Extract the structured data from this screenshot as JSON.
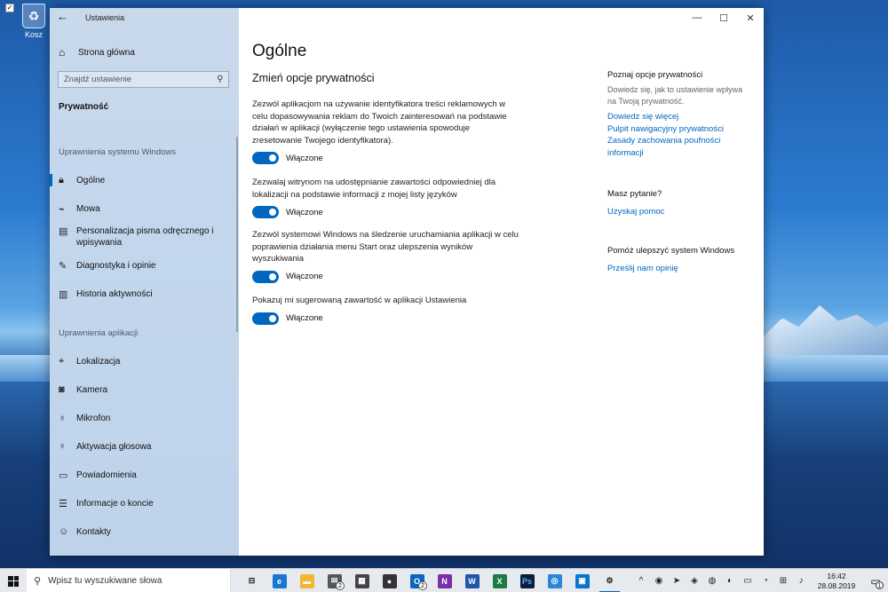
{
  "desktop": {
    "recycle_bin_label": "Kosz"
  },
  "window": {
    "title": "Ustawienia",
    "controls": {
      "minimize": "—",
      "maximize": "☐",
      "close": "✕"
    }
  },
  "sidebar": {
    "home_label": "Strona główna",
    "search_placeholder": "Znajdź ustawienie",
    "current_section": "Prywatność",
    "groups": [
      {
        "header": "Uprawnienia systemu Windows"
      },
      {
        "header": "Uprawnienia aplikacji"
      }
    ],
    "items": [
      {
        "label": "Ogólne",
        "icon": "lock-icon"
      },
      {
        "label": "Mowa",
        "icon": "speech-icon"
      },
      {
        "label": "Personalizacja pisma odręcznego i wpisywania",
        "icon": "clipboard-icon"
      },
      {
        "label": "Diagnostyka i opinie",
        "icon": "feedback-icon"
      },
      {
        "label": "Historia aktywności",
        "icon": "history-icon"
      },
      {
        "label": "Lokalizacja",
        "icon": "location-icon"
      },
      {
        "label": "Kamera",
        "icon": "camera-icon"
      },
      {
        "label": "Mikrofon",
        "icon": "microphone-icon"
      },
      {
        "label": "Aktywacja głosowa",
        "icon": "voice-activation-icon"
      },
      {
        "label": "Powiadomienia",
        "icon": "notifications-icon"
      },
      {
        "label": "Informacje o koncie",
        "icon": "account-info-icon"
      },
      {
        "label": "Kontakty",
        "icon": "contacts-icon"
      }
    ]
  },
  "main": {
    "title": "Ogólne",
    "subtitle": "Zmień opcje prywatności",
    "options": [
      {
        "text": "Zezwól aplikacjom na używanie identyfikatora treści reklamowych w celu dopasowywania reklam do Twoich zainteresowań na podstawie działań w aplikacji (wyłączenie tego ustawienia spowoduje zresetowanie Twojego identyfikatora).",
        "state": "Włączone",
        "on": true
      },
      {
        "text": "Zezwalaj witrynom na udostępnianie zawartości odpowiedniej dla lokalizacji na podstawie informacji z mojej listy języków",
        "state": "Włączone",
        "on": true
      },
      {
        "text": "Zezwól systemowi Windows na śledzenie uruchamiania aplikacji w celu poprawienia działania menu Start oraz ulepszenia wyników wyszukiwania",
        "state": "Włączone",
        "on": true
      },
      {
        "text": "Pokazuj mi sugerowaną zawartość w aplikacji Ustawienia",
        "state": "Włączone",
        "on": true
      }
    ]
  },
  "aside": {
    "privacy": {
      "header": "Poznaj opcje prywatności",
      "text": "Dowiedz się, jak to ustawienie wpływa na Twoją prywatność.",
      "links": [
        "Dowiedz się więcej",
        "Pulpit nawigacyjny prywatności",
        "Zasady zachowania poufności informacji"
      ]
    },
    "question": {
      "header": "Masz pytanie?",
      "link": "Uzyskaj pomoc"
    },
    "improve": {
      "header": "Pomóż ulepszyć system Windows",
      "link": "Prześlij nam opinię"
    }
  },
  "taskbar": {
    "search_placeholder": "Wpisz tu wyszukiwane słowa",
    "apps": [
      {
        "name": "task-view-icon",
        "glyph": "⊟",
        "color": "#e6e9ee",
        "fg": "#222"
      },
      {
        "name": "edge-icon",
        "glyph": "e",
        "color": "#1976d2",
        "fg": "#fff"
      },
      {
        "name": "file-explorer-icon",
        "glyph": "▬",
        "color": "#f2b630",
        "fg": "#fff"
      },
      {
        "name": "mail-icon",
        "glyph": "✉",
        "color": "#555",
        "fg": "#fff",
        "badge": "2"
      },
      {
        "name": "calendar-icon",
        "glyph": "▦",
        "color": "#444",
        "fg": "#fff"
      },
      {
        "name": "people-icon",
        "glyph": "●",
        "color": "#333",
        "fg": "#fff"
      },
      {
        "name": "outlook-icon",
        "glyph": "O",
        "color": "#0a64c2",
        "fg": "#fff",
        "badge": "2"
      },
      {
        "name": "onenote-icon",
        "glyph": "N",
        "color": "#7b2fa7",
        "fg": "#fff"
      },
      {
        "name": "word-icon",
        "glyph": "W",
        "color": "#1e56a8",
        "fg": "#fff"
      },
      {
        "name": "excel-icon",
        "glyph": "X",
        "color": "#1e7a43",
        "fg": "#fff"
      },
      {
        "name": "photoshop-icon",
        "glyph": "Ps",
        "color": "#0d1c3a",
        "fg": "#4bb4ff"
      },
      {
        "name": "app-icon",
        "glyph": "◎",
        "color": "#2a87d8",
        "fg": "#fff"
      },
      {
        "name": "trello-icon",
        "glyph": "▣",
        "color": "#0a74c9",
        "fg": "#fff"
      },
      {
        "name": "settings-icon",
        "glyph": "⚙",
        "color": "#e6e9ee",
        "fg": "#222",
        "active": true
      }
    ],
    "tray": [
      "^",
      "◉",
      "➤",
      "◈",
      "◍",
      "◐",
      "▭",
      "◔",
      "⊞",
      "♪"
    ],
    "time": "16:42",
    "date": "28.08.2019",
    "notifications_count": "1"
  }
}
